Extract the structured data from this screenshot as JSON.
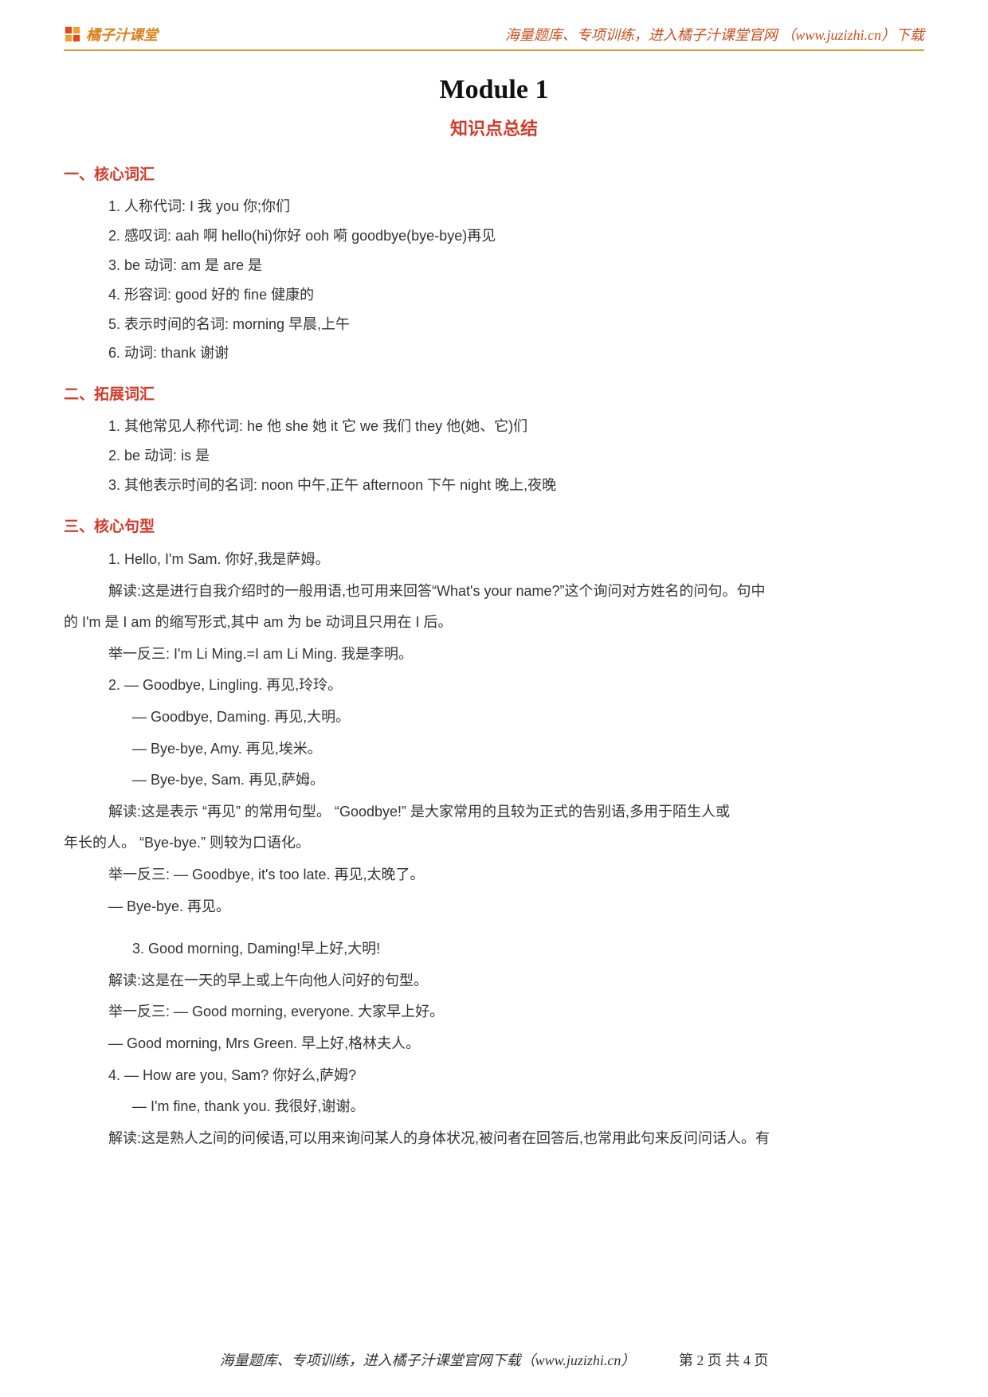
{
  "header": {
    "logo_text": "橘子汁课堂",
    "right_text": "海量题库、专项训练，进入橘子汁课堂官网 （www.juzizhi.cn）下载"
  },
  "title": "Module 1",
  "subtitle": "知识点总结",
  "section1": {
    "heading": "一、核心词汇",
    "items": [
      "1.  人称代词: I 我    you 你;你们",
      "2.  感叹词: aah 啊    hello(hi)你好    ooh 嗬    goodbye(bye-bye)再见",
      "3. be 动词: am 是    are 是",
      "4.  形容词: good 好的    fine 健康的",
      "5.  表示时间的名词: morning 早晨,上午",
      "6.  动词: thank 谢谢"
    ]
  },
  "section2": {
    "heading": "二、拓展词汇",
    "items": [
      "1.  其他常见人称代词: he 他    she 她    it 它    we 我们    they 他(她、它)们",
      "2. be 动词: is 是",
      "3.  其他表示时间的名词: noon 中午,正午    afternoon 下午    night 晚上,夜晚"
    ]
  },
  "section3": {
    "heading": "三、核心句型",
    "lines": [
      "1. Hello, I'm Sam.  你好,我是萨姆。",
      "解读:这是进行自我介绍时的一般用语,也可用来回答“What's your name?”这个询问对方姓名的问句。句中",
      "的 I'm  是 I am 的缩写形式,其中 am 为 be 动词且只用在 I 后。",
      "举一反三: I'm Li Ming.=I am Li Ming.  我是李明。",
      "2.  — Goodbye, Lingling.  再见,玲玲。",
      "      — Goodbye, Daming.  再见,大明。",
      "      — Bye-bye, Amy.  再见,埃米。",
      "      — Bye-bye, Sam.  再见,萨姆。",
      "解读:这是表示  “再见”  的常用句型。 “Goodbye!”  是大家常用的且较为正式的告别语,多用于陌生人或",
      "年长的人。 “Bye-bye.”  则较为口语化。",
      "举一反三:  — Goodbye, it's too late.  再见,太晚了。",
      "— Bye-bye.  再见。",
      "",
      "3. Good morning, Daming!早上好,大明!",
      "解读:这是在一天的早上或上午向他人问好的句型。",
      "举一反三:  — Good morning, everyone.  大家早上好。",
      "— Good morning, Mrs Green.  早上好,格林夫人。",
      "4.  — How are you, Sam?  你好么,萨姆?",
      "      — I'm fine, thank you.  我很好,谢谢。",
      "解读:这是熟人之间的问候语,可以用来询问某人的身体状况,被问者在回答后,也常用此句来反问问话人。有"
    ],
    "line_indents": [
      56,
      56,
      0,
      56,
      56,
      86,
      86,
      86,
      56,
      0,
      56,
      56,
      0,
      86,
      56,
      56,
      56,
      56,
      86,
      56
    ]
  },
  "footer": {
    "text": "海量题库、专项训练，进入橘子汁课堂官网下载（www.juzizhi.cn）",
    "page_label": "第 2 页 共 4 页"
  }
}
